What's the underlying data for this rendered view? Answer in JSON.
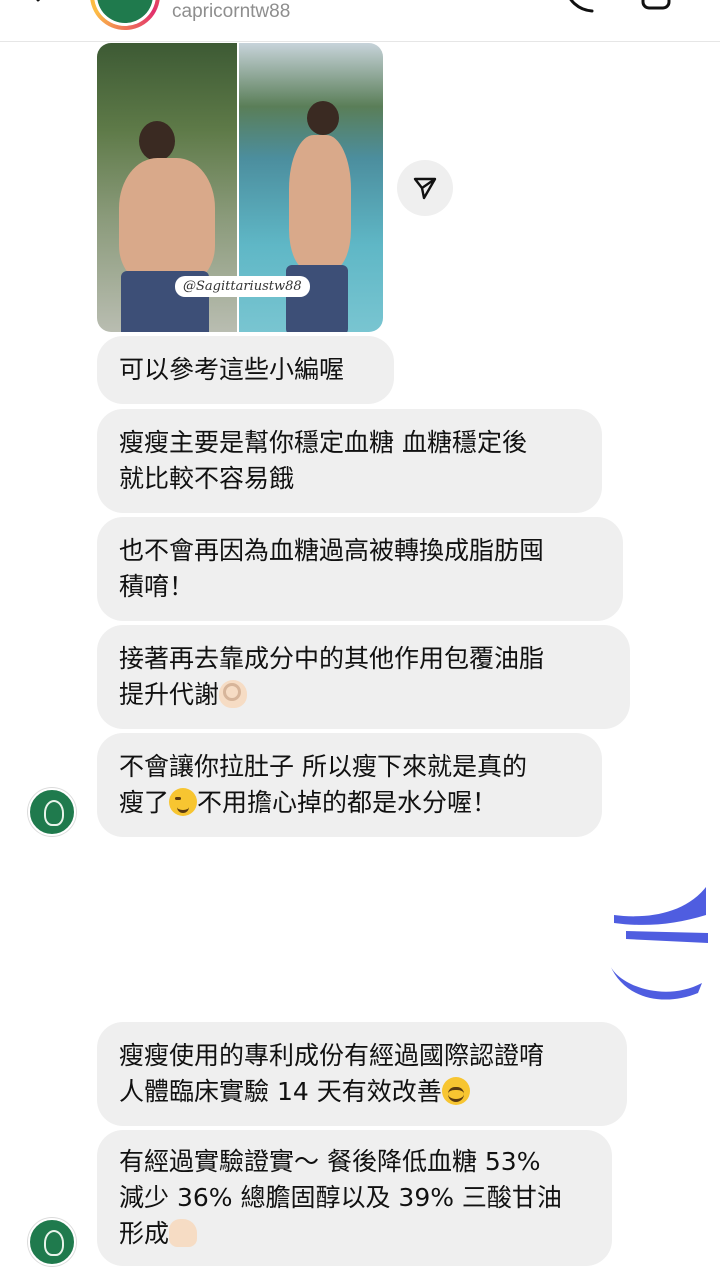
{
  "header": {
    "username": "capricorntw88"
  },
  "photo": {
    "watermark": "@Sagittariustw88"
  },
  "messages": [
    {
      "text": "可以參考這些小編喔"
    },
    {
      "line1": "瘦瘦主要是幫你穩定血糖 血糖穩定後",
      "line2": "就比較不容易餓"
    },
    {
      "line1": "也不會再因為血糖過高被轉換成脂肪囤",
      "line2": "積唷！"
    },
    {
      "line1": "接著再去靠成分中的其他作用包覆油脂",
      "line2": "提升代謝",
      "emoji": "ok-hand-emoji"
    },
    {
      "line1": "不會讓你拉肚子 所以瘦下來就是真的",
      "line2a": "瘦了",
      "emoji": "wink-emoji",
      "line2b": "不用擔心掉的都是水分喔！"
    },
    {
      "line1": "瘦瘦使用的專利成份有經過國際認證唷",
      "line2": "人體臨床實驗 14 天有效改善",
      "emoji": "smile-emoji"
    },
    {
      "line1": "有經過實驗證實～ 餐後降低血糖 53%",
      "line2": "減少 36% 總膽固醇以及 39% 三酸甘油",
      "line3": "形成",
      "emoji": "thumbs-up-emoji"
    }
  ],
  "colors": {
    "bubble": "#efefef",
    "sticker": "#4f5de0",
    "avatar": "#1f7a4d"
  },
  "icons": [
    "back-arrow-icon",
    "phone-icon",
    "video-icon",
    "share-icon"
  ]
}
